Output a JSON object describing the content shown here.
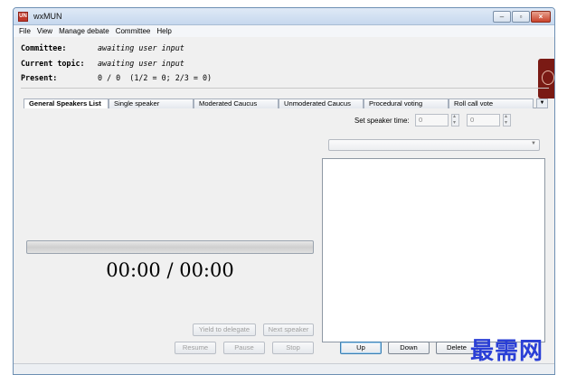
{
  "window": {
    "title": "wxMUN",
    "icon_text": "UN",
    "controls": [
      "minimize-icon",
      "maximize-icon",
      "close-icon"
    ]
  },
  "menu": [
    "File",
    "View",
    "Manage debate",
    "Committee",
    "Help"
  ],
  "info": {
    "committee_label": "Committee:",
    "committee_value": "awaiting user input",
    "topic_label": "Current topic:",
    "topic_value": "awaiting user input",
    "present_label": "Present:",
    "present_value": "0 / 0  (1/2 = 0; 2/3 = 0)"
  },
  "tabs": [
    "General Speakers List",
    "Single speaker",
    "Moderated Caucus",
    "Unmoderated Caucus",
    "Procedural voting",
    "Roll call vote"
  ],
  "speaker_time": {
    "label": "Set speaker time:",
    "minutes": "0",
    "seconds": "0"
  },
  "timer": "00:00 / 00:00",
  "buttons": {
    "yield": "Yield to delegate",
    "next": "Next speaker",
    "resume": "Resume",
    "pause": "Pause",
    "stop": "Stop",
    "up": "Up",
    "down": "Down",
    "delete": "Delete"
  },
  "watermark": "最需网"
}
